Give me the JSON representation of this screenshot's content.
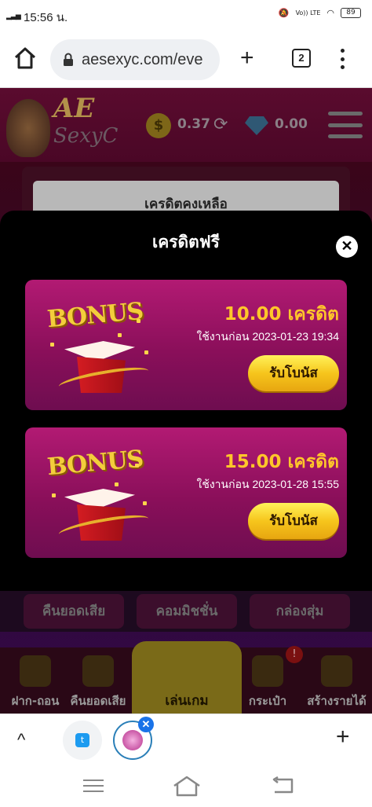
{
  "status_bar": {
    "time": "15:56 น.",
    "network": "Vo)) LTE",
    "battery": "89"
  },
  "browser": {
    "url": "aesexyc.com/eve",
    "tab_count": "2"
  },
  "site": {
    "logo_top": "AE",
    "logo_bottom": "SexyC",
    "coin_symbol": "$",
    "coin_balance": "0.37",
    "gem_balance": "0.00",
    "credit_balance_label": "เครดิตคงเหลือ"
  },
  "modal": {
    "title": "เครดิตฟรี",
    "close_symbol": "✕",
    "bonuses": [
      {
        "art_text": "BONUS",
        "amount": "10.00 เครดิต",
        "expiry": "ใช้งานก่อน 2023-01-23 19:34",
        "button": "รับโบนัส"
      },
      {
        "art_text": "BONUS",
        "amount": "15.00 เครดิต",
        "expiry": "ใช้งานก่อน 2023-01-28 15:55",
        "button": "รับโบนัส"
      }
    ]
  },
  "menu_row": [
    "คืนยอดเสีย",
    "คอมมิชชั่น",
    "กล่องสุ่ม"
  ],
  "bottom_nav": {
    "items": [
      "ฝาก-ถอน",
      "คืนยอดเสีย",
      "เล่นเกม",
      "กระเป๋า",
      "สร้างรายได้"
    ],
    "badge": "!"
  },
  "browser_bottom": {
    "up": "^",
    "twitter_glyph": "t",
    "close_tab": "✕",
    "add": "+"
  },
  "colors": {
    "card_top": "#b21a73",
    "card_bottom": "#6e0d50",
    "amount": "#ffc62a",
    "button": "#f6c51c"
  }
}
